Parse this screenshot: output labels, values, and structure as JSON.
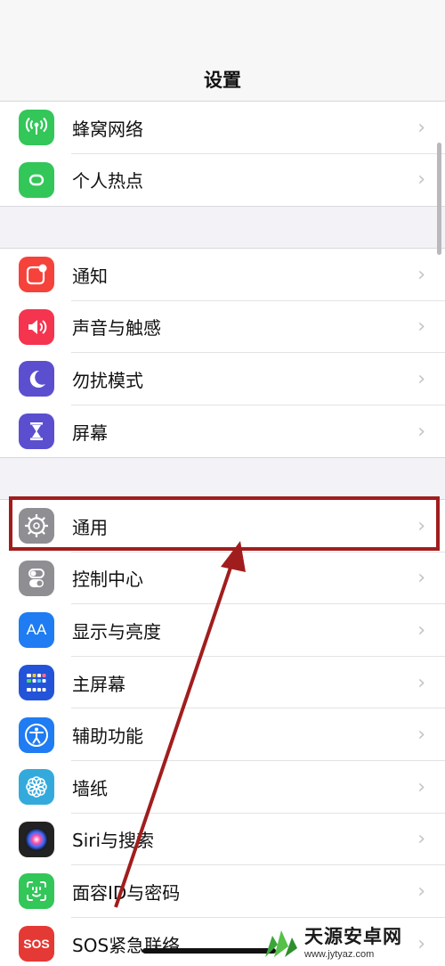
{
  "header": {
    "title": "设置"
  },
  "groups": [
    {
      "items": [
        {
          "label": "蜂窝网络",
          "icon": "cellular-antenna-icon",
          "color": "#33c659"
        },
        {
          "label": "个人热点",
          "icon": "personal-hotspot-icon",
          "color": "#33c659"
        }
      ]
    },
    {
      "items": [
        {
          "label": "通知",
          "icon": "notifications-icon",
          "color": "#f5423a"
        },
        {
          "label": "声音与触感",
          "icon": "speaker-icon",
          "color": "#f5344f"
        },
        {
          "label": "勿扰模式",
          "icon": "moon-icon",
          "color": "#5b4fd0"
        },
        {
          "label": "屏幕",
          "icon": "hourglass-icon",
          "color": "#5b4fd0"
        }
      ]
    },
    {
      "items": [
        {
          "label": "通用",
          "icon": "gear-icon",
          "color": "#8e8e93"
        },
        {
          "label": "控制中心",
          "icon": "toggle-switches-icon",
          "color": "#8e8e93"
        },
        {
          "label": "显示与亮度",
          "icon": "text-size-aa-icon",
          "color": "#1f7cf2"
        },
        {
          "label": "主屏幕",
          "icon": "home-screen-grid-icon",
          "color": "#2253d9"
        },
        {
          "label": "辅助功能",
          "icon": "accessibility-person-icon",
          "color": "#1f7cf2"
        },
        {
          "label": "墙纸",
          "icon": "wallpaper-flower-icon",
          "color": "#34aadc"
        },
        {
          "label": "Siri与搜索",
          "icon": "siri-icon",
          "color": "#222222"
        },
        {
          "label": "面容ID与密码",
          "icon": "face-id-icon",
          "color": "#33c659"
        },
        {
          "label": "SOS紧急联络",
          "icon": "sos-icon",
          "color": "#e53935"
        }
      ]
    }
  ],
  "highlight": {
    "item": "通用",
    "color": "#a11d1d"
  },
  "watermark": {
    "name": "天源安卓网",
    "url": "www.jytyaz.com"
  }
}
